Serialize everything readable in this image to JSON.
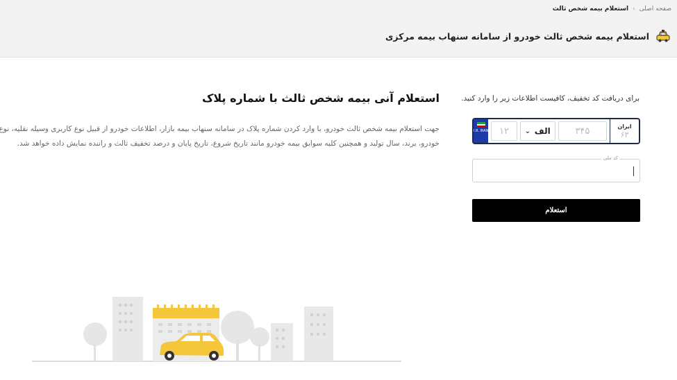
{
  "breadcrumb": {
    "home": "صفحه اصلی",
    "separator": "›",
    "current": "استعلام بیمه شخص ثالث"
  },
  "header": {
    "title": "استعلام بیمه شخص ثالث خودرو از سامانه سنهاب بیمه مرکزی",
    "icon": "car-icon"
  },
  "info": {
    "title": "استعلام آنی بیمه شخص ثالث با شماره پلاک",
    "description": "جهت استعلام بیمه شخص ثالث خودرو، با وارد کردن شماره پلاک در سامانه سنهاب بیمه بازار، اطلاعات خودرو از قبیل نوع کاربری وسیله نقلیه، نوع خودرو، برند، سال تولید و همچنین کلیه سوابق بیمه خودرو مانند تاریخ شروع، تاریخ پایان و درصد تخفیف ثالث و راننده نمایش داده خواهد شد."
  },
  "form": {
    "hint": "برای دریافت کد تخفیف، کافیست اطلاعات زیر را وارد کنید.",
    "plate": {
      "flag_text": "I.R. IRAN",
      "two_digit_placeholder": "۱۲",
      "letter": "الف",
      "three_digit_placeholder": "۳۴۵",
      "iran_label": "ایران",
      "iran_placeholder": "۶۳"
    },
    "national_code_label": "کد ملی",
    "national_code_value": "",
    "submit_label": "استعلام"
  },
  "colors": {
    "accent_yellow": "#f3c63b",
    "button_bg": "#000000",
    "plate_blue": "#1d3ba8"
  }
}
